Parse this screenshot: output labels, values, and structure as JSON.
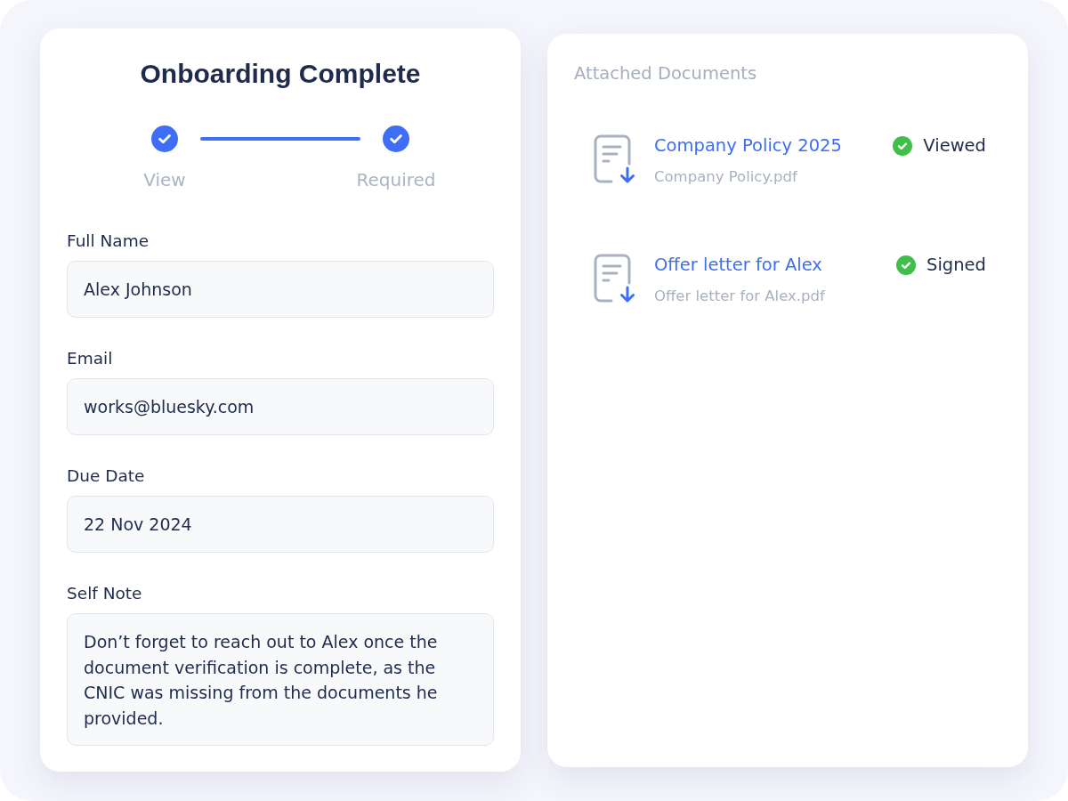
{
  "title": "Onboarding Complete",
  "steps": [
    {
      "label": "View",
      "completed": true
    },
    {
      "label": "Required",
      "completed": true
    }
  ],
  "fields": [
    {
      "kind": "input",
      "label": "Full Name",
      "value": "Alex Johnson"
    },
    {
      "kind": "input",
      "label": "Email",
      "value": "works@bluesky.com"
    },
    {
      "kind": "input",
      "label": "Due Date",
      "value": "22 Nov 2024"
    },
    {
      "kind": "textarea",
      "label": "Self Note",
      "value": "Don’t forget to reach out to Alex once the document verification is complete, as the CNIC was missing from the documents he provided."
    }
  ],
  "attachments": {
    "heading": "Attached Documents",
    "documents": [
      {
        "title": "Company Policy 2025",
        "file": "Company Policy.pdf",
        "status": "Viewed",
        "done": true
      },
      {
        "title": "Offer letter for Alex",
        "file": "Offer letter for Alex.pdf",
        "status": "Signed",
        "done": true
      }
    ]
  }
}
